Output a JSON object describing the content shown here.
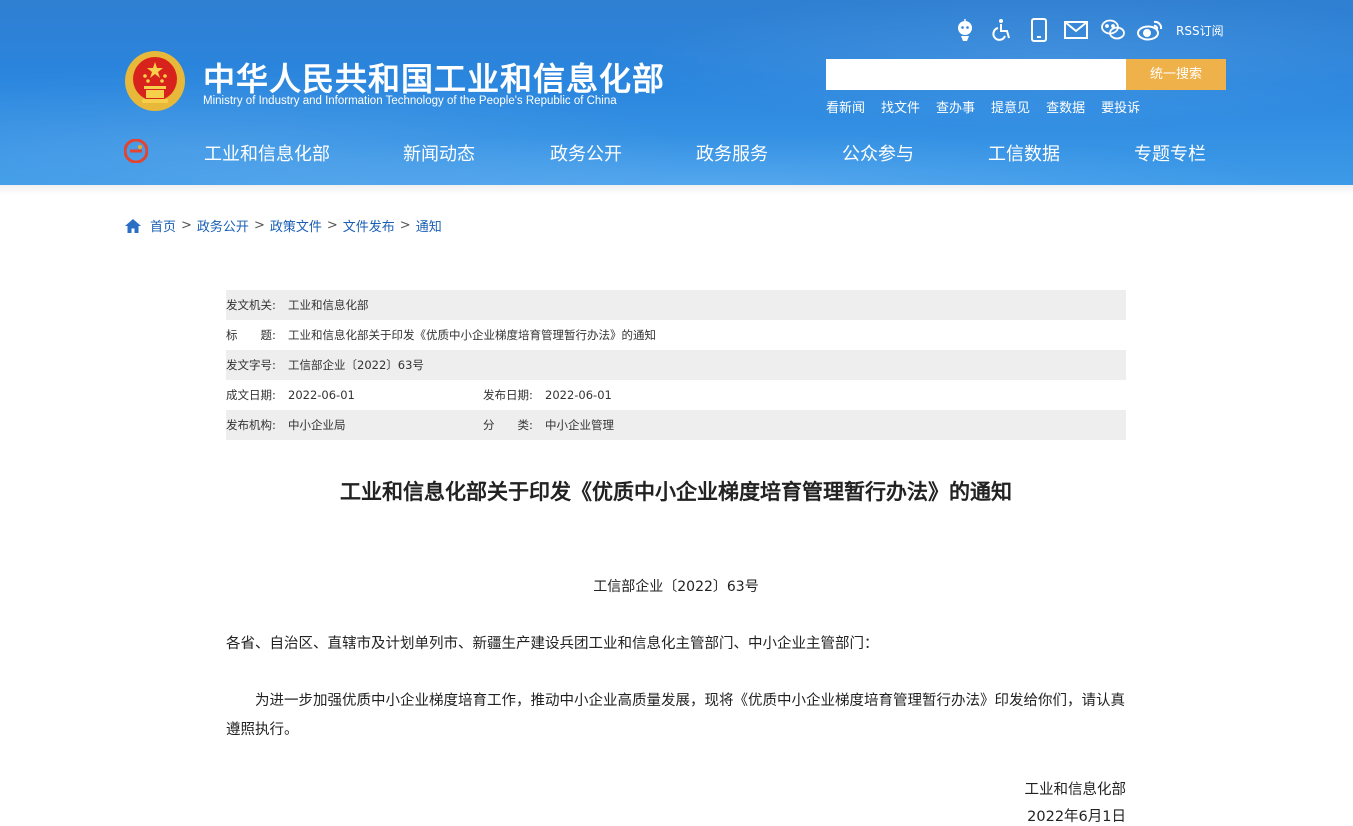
{
  "header": {
    "title": "中华人民共和国工业和信息化部",
    "subtitle": "Ministry of Industry and Information Technology of the People's Republic of China",
    "rss_label": "RSS订阅",
    "search_placeholder": "",
    "search_button": "统一搜索",
    "quick_links": [
      "看新闻",
      "找文件",
      "查办事",
      "提意见",
      "查数据",
      "要投诉"
    ],
    "top_icons": [
      "robot-assistant-icon",
      "accessibility-icon",
      "mobile-icon",
      "mail-icon",
      "wechat-icon",
      "weibo-icon"
    ]
  },
  "nav": {
    "items": [
      "工业和信息化部",
      "新闻动态",
      "政务公开",
      "政务服务",
      "公众参与",
      "工信数据",
      "专题专栏"
    ]
  },
  "breadcrumb": [
    "首页",
    "政务公开",
    "政策文件",
    "文件发布",
    "通知"
  ],
  "meta": {
    "issuer_label": "发文机关:",
    "issuer": "工业和信息化部",
    "title_label": "标　　题:",
    "title": "工业和信息化部关于印发《优质中小企业梯度培育管理暂行办法》的通知",
    "doc_no_label": "发文字号:",
    "doc_no": "工信部企业〔2022〕63号",
    "created_label": "成文日期:",
    "created": "2022-06-01",
    "published_label": "发布日期:",
    "published": "2022-06-01",
    "org_label": "发布机构:",
    "org": "中小企业局",
    "category_label": "分　　类:",
    "category": "中小企业管理"
  },
  "document": {
    "title": "工业和信息化部关于印发《优质中小企业梯度培育管理暂行办法》的通知",
    "number": "工信部企业〔2022〕63号",
    "salutation": "各省、自治区、直辖市及计划单列市、新疆生产建设兵团工业和信息化主管部门、中小企业主管部门：",
    "paragraph": "为进一步加强优质中小企业梯度培育工作，推动中小企业高质量发展，现将《优质中小企业梯度培育管理暂行办法》印发给你们，请认真遵照执行。",
    "signature": "工业和信息化部",
    "date": "2022年6月1日"
  },
  "colors": {
    "header_blue": "#2a86de",
    "search_button": "#efb14a",
    "link": "#1a5fb4"
  }
}
